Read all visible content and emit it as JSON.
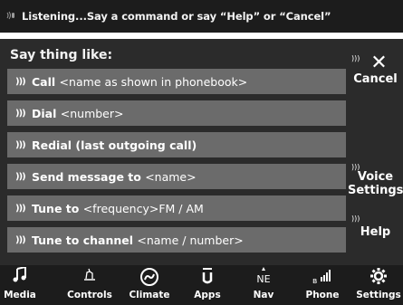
{
  "status_bar": {
    "icon": "voice-listening-icon",
    "text": "Listening...Say a command or say “Help” or “Cancel”"
  },
  "main": {
    "title": "Say thing like:",
    "commands": [
      {
        "prefix": "Call",
        "detail": "<name as shown in phonebook>"
      },
      {
        "prefix": "Dial",
        "detail": "<number>"
      },
      {
        "prefix": "Redial (last outgoing call)",
        "detail": ""
      },
      {
        "prefix": "Send message to",
        "detail": "<name>"
      },
      {
        "prefix": "Tune to",
        "detail": "<frequency>FM / AM"
      },
      {
        "prefix": "Tune to channel",
        "detail": "<name / number>"
      }
    ],
    "speak_icon_glyph": ")))"
  },
  "side_buttons": {
    "cancel_label": "Cancel",
    "voice_settings_label_1": "Voice",
    "voice_settings_label_2": "Settings",
    "help_label": "Help",
    "voice_glyph": ")))"
  },
  "nav": {
    "items": [
      {
        "label": "Media",
        "icon": "music-note-icon",
        "glyph": "♫"
      },
      {
        "label": "Controls",
        "icon": "controls-icon",
        "glyph": "✍"
      },
      {
        "label": "Climate",
        "icon": "climate-icon",
        "glyph": "⊛"
      },
      {
        "label": "Apps",
        "icon": "apps-icon",
        "glyph": "û"
      },
      {
        "label": "Nav",
        "icon": "compass-icon",
        "glyph": "NE"
      },
      {
        "label": "Phone",
        "icon": "phone-signal-icon",
        "glyph": "ııll"
      },
      {
        "label": "Settings",
        "icon": "gear-icon",
        "glyph": "⚙"
      }
    ]
  },
  "colors": {
    "bar_bg": "#1c1c1c",
    "main_bg": "#2b2b2b",
    "item_bg": "#6b6b6b",
    "text": "#ffffff"
  }
}
